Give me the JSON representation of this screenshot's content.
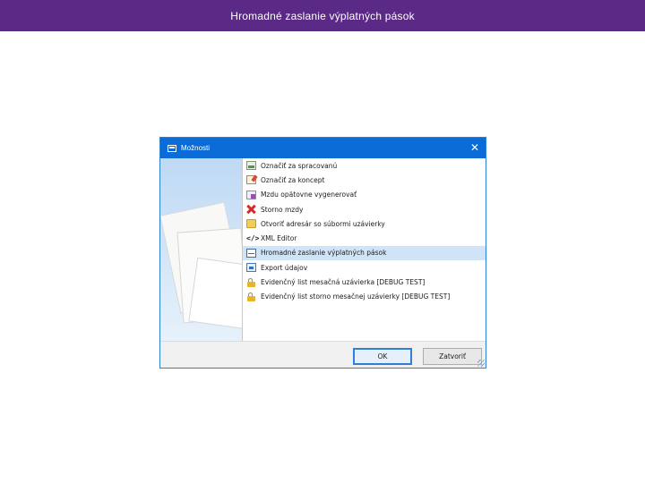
{
  "slide": {
    "title": "Hromadné zaslanie výplatných pások"
  },
  "colors": {
    "header_bg": "#5b2a86",
    "titlebar_bg": "#0b6cd8",
    "selection_bg": "#cfe4f7"
  },
  "dialog": {
    "title": "Možnosti",
    "close_glyph": "✕",
    "items": [
      {
        "label": "Označiť za spracovanú",
        "icon": "mark-processed-icon"
      },
      {
        "label": "Označiť za koncept",
        "icon": "edit-draft-icon"
      },
      {
        "label": "Mzdu opätovne vygenerovať",
        "icon": "regenerate-icon"
      },
      {
        "label": "Storno mzdy",
        "icon": "cancel-x-icon"
      },
      {
        "label": "Otvoriť adresár so súbormi uzávierky",
        "icon": "folder-icon"
      },
      {
        "label": "XML Editor",
        "icon": "code-icon",
        "glyph": "</>"
      },
      {
        "label": "Hromadné zaslanie výplatných pások",
        "icon": "mail-icon",
        "selected": true
      },
      {
        "label": "Export údajov",
        "icon": "export-icon"
      },
      {
        "label": "Evidenčný list mesačná uzávierka [DEBUG TEST]",
        "icon": "lock-icon"
      },
      {
        "label": "Evidenčný list storno mesačnej uzávierky [DEBUG TEST]",
        "icon": "lock-icon"
      }
    ],
    "buttons": {
      "ok": "OK",
      "close": "Zatvoriť"
    }
  }
}
